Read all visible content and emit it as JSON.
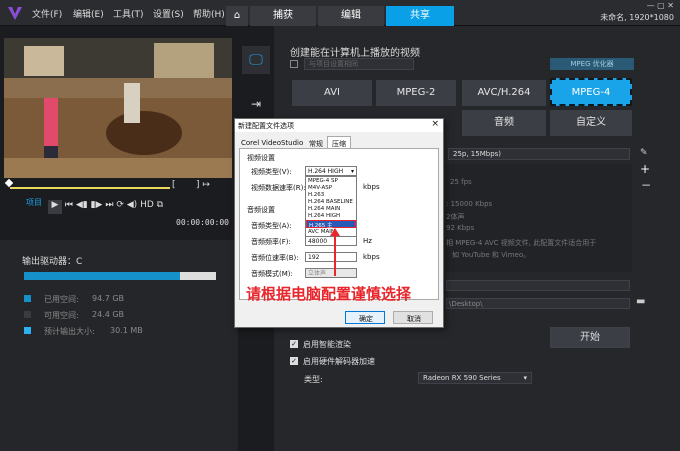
{
  "menu": [
    "文件(F)",
    "编辑(E)",
    "工具(T)",
    "设置(S)",
    "帮助(H)"
  ],
  "tabs": {
    "capture": "捕获",
    "edit": "编辑",
    "share": "共享"
  },
  "project_title": "未命名, 1920*1080",
  "header": "创建能在计算机上播放的视频",
  "match_project": "与项目设置相同",
  "mpeg_optimizer": "MPEG 优化器",
  "formats": {
    "avi": "AVI",
    "mpeg2": "MPEG-2",
    "avch264": "AVC/H.264",
    "mpeg4": "MPEG-4",
    "audio": "音频",
    "custom": "自定义"
  },
  "profile_text": "25p, 15Mbps)",
  "info": {
    "fps": "25 fps",
    "bitrate": ": 15000 Kbps",
    "channels": "2体声",
    "khz": "92 Kbps",
    "desc1": "相 MPEG-4 AVC 视频文件, 此配置文件适合用于",
    "desc2": "如 YouTube 和 Vimeo。"
  },
  "path": "\\Desktop\\",
  "start_button": "开始",
  "checkbox1": "启用智能渲染",
  "checkbox2": "启用硬件解码器加速",
  "type_label": "类型:",
  "gpu": "Radeon RX 590 Series",
  "project_label": "项目",
  "timecode": "00:00:00:00",
  "hd_label": "HD",
  "output_drive": "输出驱动器：C",
  "storage": {
    "used_label": "已用空间:",
    "used_value": "94.7 GB",
    "free_label": "可用空间:",
    "free_value": "24.4 GB",
    "estimate_label": "预计输出大小:",
    "estimate_value": "30.1 MB"
  },
  "dialog": {
    "title": "新建配置文件选项",
    "tabs": [
      "Corel VideoStudio",
      "常规",
      "压缩"
    ],
    "video_group": "视频设置",
    "video_type_label": "视频类型(V):",
    "video_type_value": "H.264 HIGH",
    "video_options": [
      "MPEG-4 SP",
      "M4V-ASP",
      "H.263",
      "H.264 BASELINE",
      "H.264 MAIN",
      "H.264 HIGH",
      "H.265 主",
      "AVC MAIN"
    ],
    "video_bitrate_label": "视频数据速率(R):",
    "kbps": "kbps",
    "audio_group": "音频设置",
    "audio_type_label": "音频类型(A):",
    "audio_rate_label": "音频频率(F):",
    "audio_rate_value": "48000",
    "hz": "Hz",
    "audio_bitrate_label": "音频位速率(B):",
    "audio_bitrate_value": "192",
    "audio_mode_label": "音频模式(M):",
    "audio_mode_value": "立体声",
    "ok": "确定",
    "cancel": "取消",
    "close": "×"
  },
  "annotation": "请根据电脑配置谨慎选择",
  "colors": {
    "accent": "#0aa0e8",
    "annotation": "#e8262b",
    "used": "#1590c8"
  }
}
